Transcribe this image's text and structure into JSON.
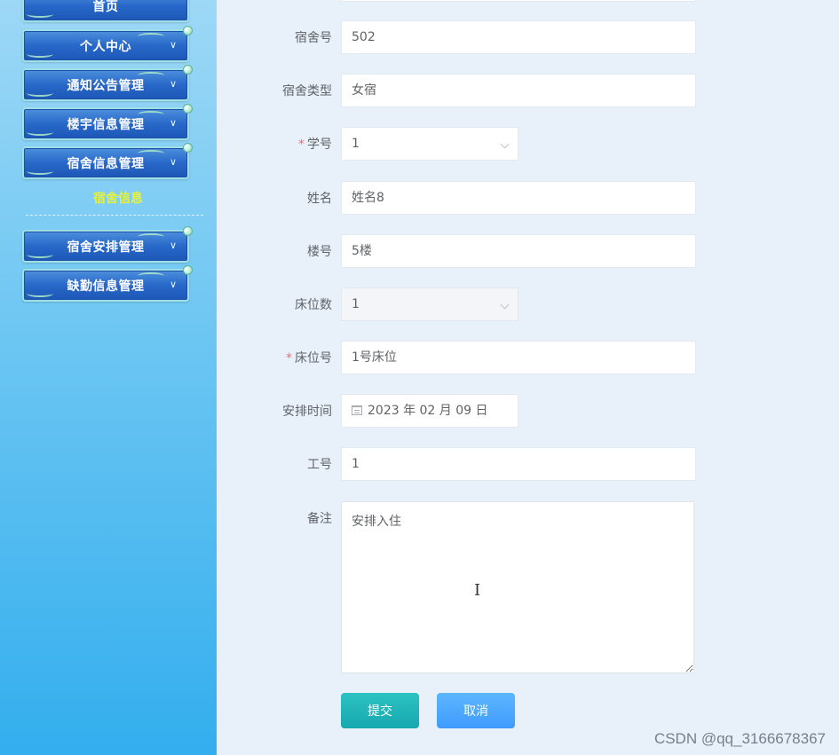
{
  "sidebar": {
    "menu": [
      {
        "label": "首页"
      },
      {
        "label": "个人中心"
      },
      {
        "label": "通知公告管理"
      },
      {
        "label": "楼宇信息管理"
      },
      {
        "label": "宿舍信息管理"
      },
      {
        "label": "宿舍安排管理"
      },
      {
        "label": "缺勤信息管理"
      }
    ],
    "active_submenu": "宿舍信息",
    "chevron_icon": "chevron-down-icon"
  },
  "form": {
    "dorm_no": {
      "label": "宿舍号",
      "value": "502"
    },
    "dorm_type": {
      "label": "宿舍类型",
      "value": "女宿"
    },
    "student_no": {
      "label": "学号",
      "required": "*",
      "value": "1"
    },
    "name": {
      "label": "姓名",
      "value": "姓名8"
    },
    "building_no": {
      "label": "楼号",
      "value": "5楼"
    },
    "bed_count": {
      "label": "床位数",
      "value": "1"
    },
    "bed_no": {
      "label": "床位号",
      "required": "*",
      "value": "1号床位"
    },
    "arrange_time": {
      "label": "安排时间",
      "value": "2023 年 02 月 09 日"
    },
    "staff_no": {
      "label": "工号",
      "value": "1"
    },
    "remark": {
      "label": "备注",
      "value": "安排入住"
    },
    "submit_label": "提交",
    "cancel_label": "取消"
  },
  "watermark": "CSDN @qq_3166678367",
  "colors": {
    "menu_button": "#2868c9",
    "submenu_active": "#e6f23a",
    "required": "#f56c6c",
    "submit": "#17a8b0",
    "cancel": "#3f9bff"
  }
}
